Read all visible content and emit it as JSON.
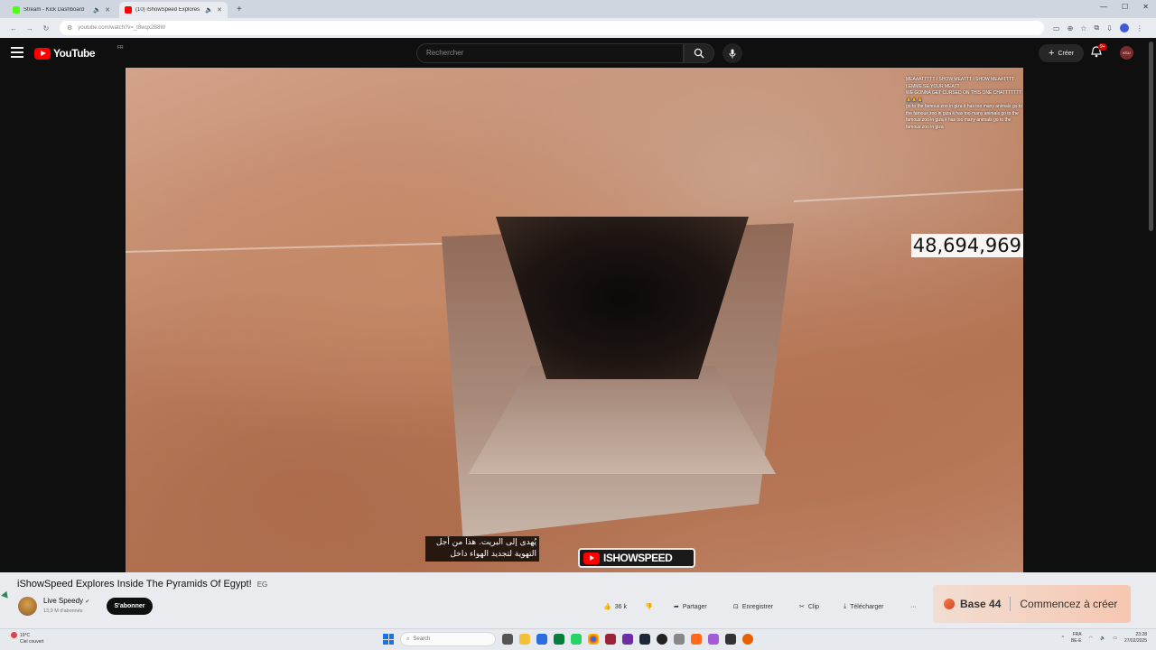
{
  "browser": {
    "tabs": [
      {
        "title": "Stream - Kick Dashboard",
        "favicon_color": "#53fc18",
        "active": false
      },
      {
        "title": "(10) iShowSpeed Explores",
        "favicon_color": "#ff0000",
        "active": true
      }
    ],
    "new_tab": "+",
    "address": "youtube.com/watch?v=_t8wqx2B8W"
  },
  "youtube": {
    "logo_text": "YouTube",
    "country_code": "FR",
    "search_placeholder": "Rechercher",
    "create_label": "Créer",
    "notifications_badge": "9+",
    "avatar_text": "KSU"
  },
  "video": {
    "chat_lines": [
      {
        "user": "",
        "text": "MEAAATTTTT I SHOW MEATTT I SHOW MEAATTTT LEMME SE YOUR MEATT"
      },
      {
        "user": "",
        "text": "WE GONNA GET CURSED ON THIS ONE CHATTTTTTT 🙏🙏🙏"
      },
      {
        "user": "",
        "text": "go to the famous zoo in giza it has too many animals go to the famous zoo in giza it has too many animals go to the famous zoo in giza it has too many animals go to the famous zoo in giza"
      }
    ],
    "counter": "48,694,969",
    "subtitle_line1": "يُهدى إلى البريت. هذا من أجل",
    "subtitle_line2": "التهوية لتجديد الهواء داخل",
    "watermark": "ISHOWSPEED"
  },
  "info": {
    "title": "iShowSpeed Explores Inside The Pyramids Of Egypt!",
    "title_tag": "EG",
    "channel": "Live Speedy",
    "subscribers": "13,9 M d'abonnés",
    "subscribe_label": "S'abonner",
    "likes": "36 k",
    "share_label": "Partager",
    "save_label": "Enregistrer",
    "clip_label": "Clip",
    "download_label": "Télécharger",
    "more": "···"
  },
  "ad": {
    "brand": "Base 44",
    "cta": "Commencez à créer"
  },
  "taskbar": {
    "weather_temp": "19°C",
    "weather_desc": "Ciel couvert",
    "search_placeholder": "Search",
    "lang": "FRA",
    "lang_sub": "BE-E",
    "time": "23:28",
    "date": "27/02/2025"
  }
}
